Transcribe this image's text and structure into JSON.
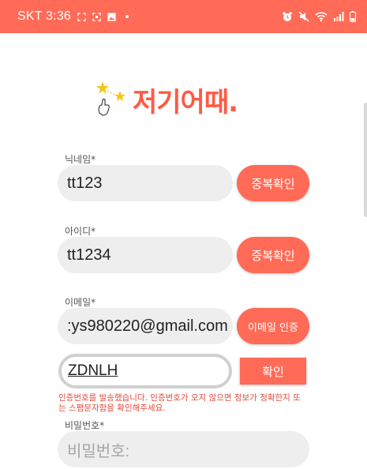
{
  "status_bar": {
    "carrier_time": "SKT 3:36",
    "background": "#ff6b57",
    "left_icons": [
      "screenshot-icon",
      "scan-icon",
      "gallery-icon",
      "dot-icon"
    ],
    "right_icons": [
      "alarm-icon",
      "mute-icon",
      "wifi-icon",
      "signal-icon",
      "battery-icon"
    ]
  },
  "logo": {
    "text": "저기어때.",
    "color": "#ff5a45"
  },
  "form": {
    "nickname": {
      "label": "닉네임*",
      "value": "tt123",
      "button": "중복확인"
    },
    "user_id": {
      "label": "아이디*",
      "value": "tt1234",
      "button": "중복확인"
    },
    "email": {
      "label": "이메일*",
      "value": ":ys980220@gmail.com",
      "button": "이메일 인증"
    },
    "verification": {
      "code": "ZDNLH",
      "button": "확인",
      "notice": "인증번호를 발송했습니다. 인증번호가 오지 않으면 정보가 정확한지 또는 스팸문자함을 확인해주세요."
    },
    "password": {
      "label": "비밀번호*",
      "placeholder": "비밀번호:"
    }
  },
  "accent_color": "#ff6b57"
}
